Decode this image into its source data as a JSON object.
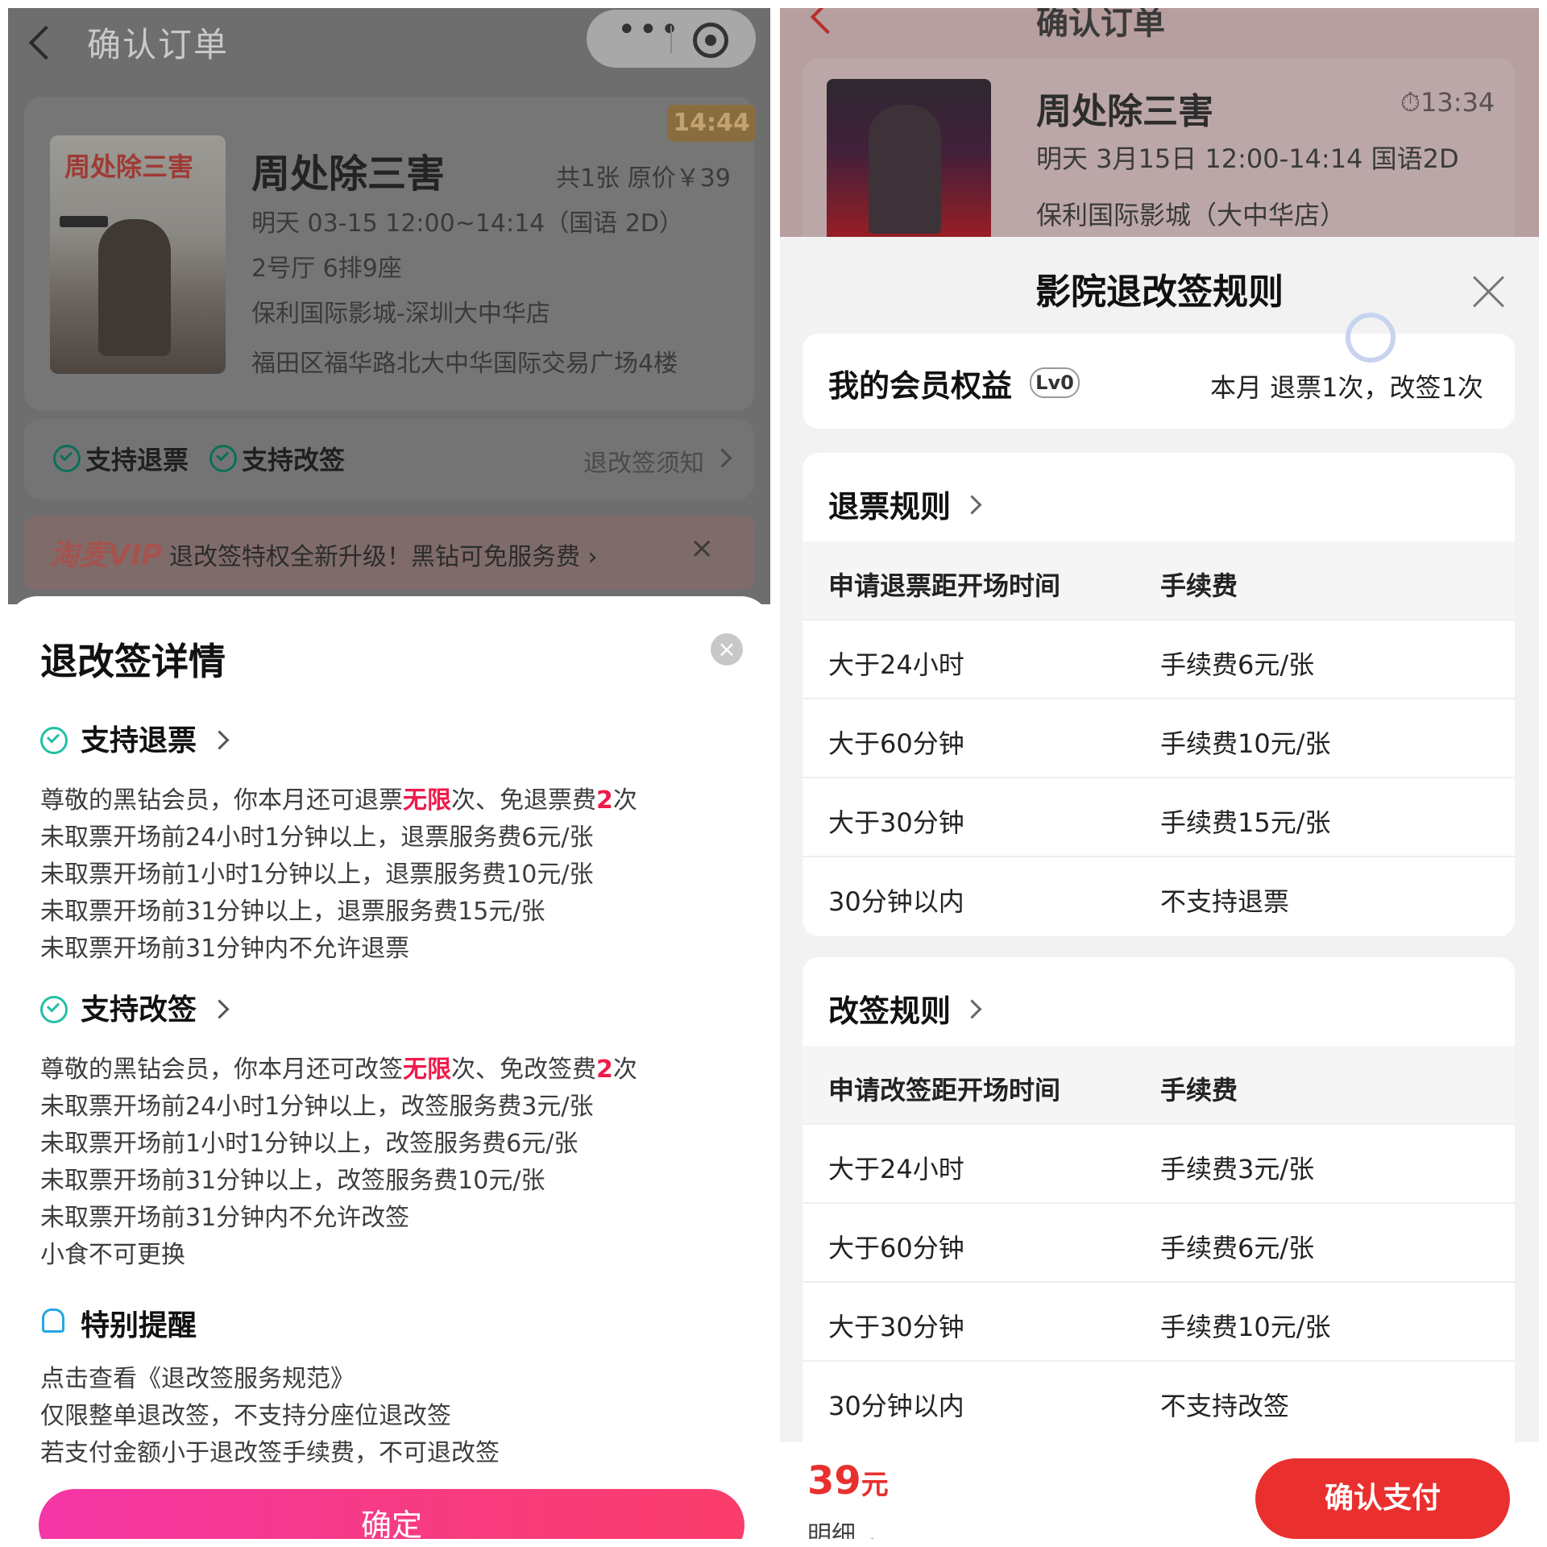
{
  "left": {
    "header": {
      "title": "确认订单"
    },
    "timer": "14:44",
    "movie": {
      "name": "周处除三害",
      "price_info": "共1张 原价￥39",
      "showtime": "明天 03-15 12:00~14:14（国语 2D）",
      "seat": "2号厅 6排9座",
      "cinema": "保利国际影城-深圳大中华店",
      "address": "福田区福华路北大中华国际交易广场4楼",
      "poster_title": "周处除三害"
    },
    "tags": {
      "refund": "支持退票",
      "change": "支持改签",
      "rule_link": "退改签须知"
    },
    "vip": {
      "logo": "淘麦VIP",
      "text": "退改签特权全新升级！黑钻可免服务费 ›",
      "close": "×"
    },
    "sheet": {
      "title": "退改签详情",
      "close": "×",
      "refund": {
        "title": "支持退票",
        "intro_pre": "尊敬的黑钻会员，你本月还可退票",
        "intro_red1": "无限",
        "intro_mid": "次、免退票费",
        "intro_red2": "2",
        "intro_post": "次",
        "lines": [
          "未取票开场前24小时1分钟以上，退票服务费6元/张",
          "未取票开场前1小时1分钟以上，退票服务费10元/张",
          "未取票开场前31分钟以上，退票服务费15元/张",
          "未取票开场前31分钟内不允许退票"
        ]
      },
      "change": {
        "title": "支持改签",
        "intro_pre": "尊敬的黑钻会员，你本月还可改签",
        "intro_red1": "无限",
        "intro_mid": "次、免改签费",
        "intro_red2": "2",
        "intro_post": "次",
        "lines": [
          "未取票开场前24小时1分钟以上，改签服务费3元/张",
          "未取票开场前1小时1分钟以上，改签服务费6元/张",
          "未取票开场前31分钟以上，改签服务费10元/张",
          "未取票开场前31分钟内不允许改签",
          "小食不可更换"
        ]
      },
      "reminder": {
        "title": "特别提醒",
        "lines": [
          "点击查看《退改签服务规范》",
          "仅限整单退改签，不支持分座位退改签",
          "若支付金额小于退改签手续费，不可退改签"
        ]
      },
      "confirm": "确定"
    }
  },
  "right": {
    "header": {
      "title": "确认订单"
    },
    "movie": {
      "name": "周处除三害",
      "countdown": "13:34",
      "showtime": "明天 3月15日 12:00-14:14 国语2D",
      "cinema": "保利国际影城（大中华店）"
    },
    "sheet": {
      "title": "影院退改签规则",
      "member": {
        "title": "我的会员权益",
        "level": "Lv0",
        "quota": "本月 退票1次，改签1次"
      },
      "refund_rules": {
        "title": "退票规则",
        "columns": [
          "申请退票距开场时间",
          "手续费"
        ],
        "rows": [
          [
            "大于24小时",
            "手续费6元/张"
          ],
          [
            "大于60分钟",
            "手续费10元/张"
          ],
          [
            "大于30分钟",
            "手续费15元/张"
          ],
          [
            "30分钟以内",
            "不支持退票"
          ]
        ]
      },
      "change_rules": {
        "title": "改签规则",
        "columns": [
          "申请改签距开场时间",
          "手续费"
        ],
        "rows": [
          [
            "大于24小时",
            "手续费3元/张"
          ],
          [
            "大于60分钟",
            "手续费6元/张"
          ],
          [
            "大于30分钟",
            "手续费10元/张"
          ],
          [
            "30分钟以内",
            "不支持改签"
          ]
        ]
      }
    },
    "bottom": {
      "price": "39",
      "unit": "元",
      "detail": "明细",
      "pay": "确认支付"
    }
  }
}
